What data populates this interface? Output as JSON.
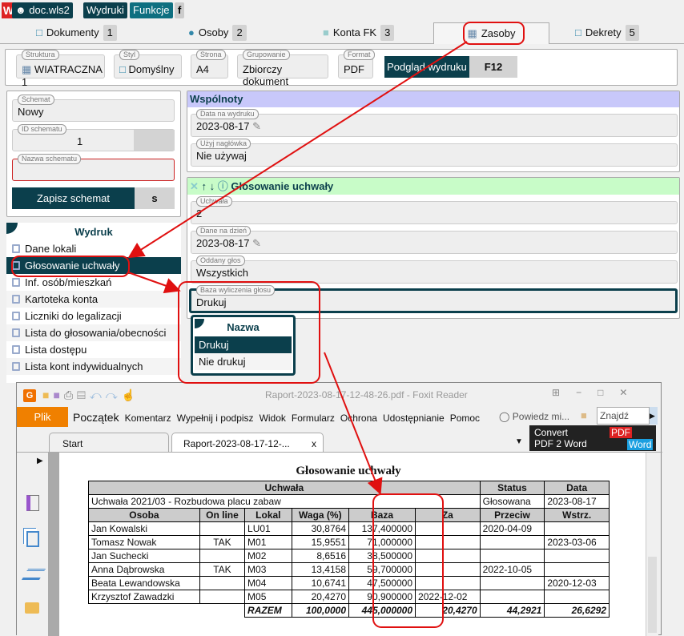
{
  "top": {
    "user": "doc.wls2",
    "wydruki": "Wydruki",
    "funkcje": "Funkcje",
    "f": "f"
  },
  "tabs": [
    {
      "label": "Dokumenty",
      "num": "1"
    },
    {
      "label": "Osoby",
      "num": "2"
    },
    {
      "label": "Konta FK",
      "num": "3"
    },
    {
      "label": "Zasoby",
      "active": true
    },
    {
      "label": "Dekrety",
      "num": "5"
    }
  ],
  "toolbar": {
    "struktura_l": "Struktura",
    "struktura": "WIATRACZNA 1",
    "styl_l": "Styl",
    "styl": "Domyślny",
    "strona_l": "Strona",
    "strona": "A4",
    "grup_l": "Grupowanie",
    "grup": "Zbiorczy dokument",
    "format_l": "Format",
    "format": "PDF",
    "preview": "Podgląd wydruku",
    "preview_key": "F12"
  },
  "schema": {
    "schemat_l": "Schemat",
    "schemat": "Nowy",
    "id_l": "ID schematu",
    "id": "1",
    "nazwa_l": "Nazwa schematu",
    "nazwa": "",
    "save": "Zapisz schemat",
    "save_key": "s"
  },
  "wydruk": {
    "title": "Wydruk",
    "items": [
      "Dane lokali",
      "Głosowanie uchwały",
      "Inf. osób/mieszkań",
      "Kartoteka konta",
      "Liczniki do legalizacji",
      "Lista do głosowania/obecności",
      "Lista dostępu",
      "Lista kont indywidualnych"
    ],
    "selected": 1
  },
  "wspolnoty": {
    "title": "Wspólnoty",
    "data_l": "Data na wydruku",
    "data": "2023-08-17",
    "nagl_l": "Użyj nagłówka",
    "nagl": "Nie używaj"
  },
  "glos": {
    "title": "Głosowanie uchwały",
    "uchwala_l": "Uchwała",
    "uchwala": "2",
    "dzien_l": "Dane na dzień",
    "dzien": "2023-08-17",
    "oddany_l": "Oddany głos",
    "oddany": "Wszystkich",
    "baza_l": "Baza wyliczenia głosu",
    "baza": "Drukuj"
  },
  "dropdown": {
    "header": "Nazwa",
    "options": [
      "Drukuj",
      "Nie drukuj"
    ],
    "selected": 0
  },
  "foxit": {
    "title": "Raport-2023-08-17-12-48-26.pdf - Foxit Reader",
    "plik": "Plik",
    "menu": [
      "Początek",
      "Komentarz",
      "Wypełnij i podpisz",
      "Widok",
      "Formularz",
      "Ochrona",
      "Udostępnianie",
      "Pomoc"
    ],
    "tell": "Powiedz mi...",
    "find": "Znajdź",
    "tab_start": "Start",
    "tab_doc": "Raport-2023-08-17-12-...",
    "tab_close": "x",
    "ad1": "Convert",
    "ad2": "PDF 2 Word",
    "ad_pdf": "PDF",
    "ad_word": "Word"
  },
  "report": {
    "title": "Głosowanie uchwały",
    "h1": [
      "Uchwała",
      "Status",
      "Data"
    ],
    "r1": [
      "Uchwała 2021/03 - Rozbudowa placu zabaw",
      "Głosowana",
      "2023-08-17"
    ],
    "cols": [
      "Osoba",
      "On line",
      "Lokal",
      "Waga (%)",
      "Baza",
      "Za",
      "Przeciw",
      "Wstrz."
    ],
    "rows": [
      [
        "Jan Kowalski",
        "",
        "LU01",
        "30,8764",
        "137,400000",
        "",
        "2020-04-09",
        ""
      ],
      [
        "Tomasz Nowak",
        "TAK",
        "M01",
        "15,9551",
        "71,000000",
        "",
        "",
        "2023-03-06"
      ],
      [
        "Jan Suchecki",
        "",
        "M02",
        "8,6516",
        "38,500000",
        "",
        "",
        ""
      ],
      [
        "Anna Dąbrowska",
        "TAK",
        "M03",
        "13,4158",
        "59,700000",
        "",
        "2022-10-05",
        ""
      ],
      [
        "Beata Lewandowska",
        "",
        "M04",
        "10,6741",
        "47,500000",
        "",
        "",
        "2020-12-03"
      ],
      [
        "Krzysztof Zawadzki",
        "",
        "M05",
        "20,4270",
        "90,900000",
        "2022-12-02",
        "",
        ""
      ]
    ],
    "total": [
      "RAZEM",
      "100,0000",
      "445,000000",
      "20,4270",
      "44,2921",
      "26,6292"
    ]
  },
  "colors": {
    "dark": "#0b3f4c",
    "annotation": "#e01010",
    "header_purple": "#c8c8fa",
    "header_green": "#c8fcc8",
    "foxit_orange": "#f08000"
  }
}
